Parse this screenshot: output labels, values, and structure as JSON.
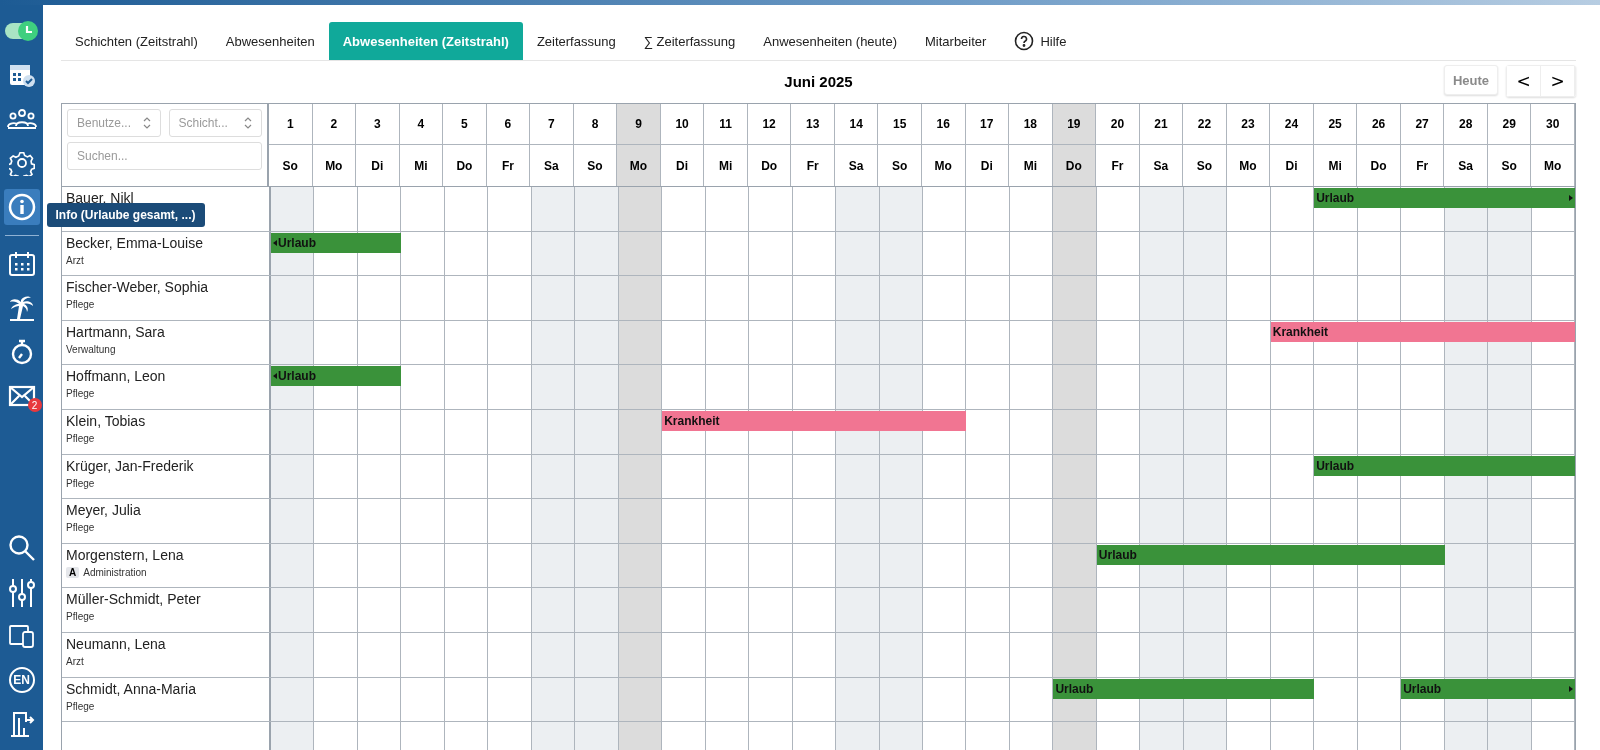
{
  "sidebar": {
    "items": [
      {
        "kind": "toggle",
        "selected": false
      },
      {
        "kind": "calendar-check",
        "selected": false
      },
      {
        "kind": "people",
        "selected": false
      },
      {
        "kind": "gear",
        "selected": false
      },
      {
        "kind": "info",
        "selected": true,
        "tooltip": "Info (Urlaube gesamt, ...)"
      },
      {
        "kind": "divider"
      },
      {
        "kind": "calendar",
        "selected": false
      },
      {
        "kind": "palm",
        "selected": false
      },
      {
        "kind": "stopwatch",
        "selected": false
      },
      {
        "kind": "mail",
        "selected": false,
        "badge": "2"
      },
      {
        "kind": "spacer"
      },
      {
        "kind": "search",
        "selected": false
      },
      {
        "kind": "sliders",
        "selected": false
      },
      {
        "kind": "devices",
        "selected": false
      },
      {
        "kind": "language",
        "selected": false,
        "label": "EN"
      },
      {
        "kind": "exit",
        "selected": false
      }
    ]
  },
  "tabs": [
    {
      "label": "Schichten (Zeitstrahl)",
      "selected": false
    },
    {
      "label": "Abwesenheiten",
      "selected": false
    },
    {
      "label": "Abwesenheiten (Zeitstrahl)",
      "selected": true
    },
    {
      "label": "Zeiterfassung",
      "selected": false
    },
    {
      "label": "∑ Zeiterfassung",
      "selected": false
    },
    {
      "label": "Anwesenheiten (heute)",
      "selected": false
    },
    {
      "label": "Mitarbeiter",
      "selected": false
    },
    {
      "label": "Hilfe",
      "selected": false,
      "kind": "help"
    }
  ],
  "month": "Juni 2025",
  "today_button": {
    "label": "Heute",
    "disabled": true
  },
  "nav": {
    "prev": "<",
    "next": ">"
  },
  "filters": {
    "user_select": {
      "placeholder": "Benutze..."
    },
    "shift_select": {
      "placeholder": "Schicht..."
    },
    "search": {
      "placeholder": "Suchen..."
    }
  },
  "days": [
    {
      "date": "1",
      "weekday": "So",
      "kind": "weekend"
    },
    {
      "date": "2",
      "weekday": "Mo",
      "kind": "normal"
    },
    {
      "date": "3",
      "weekday": "Di",
      "kind": "normal"
    },
    {
      "date": "4",
      "weekday": "Mi",
      "kind": "normal"
    },
    {
      "date": "5",
      "weekday": "Do",
      "kind": "normal"
    },
    {
      "date": "6",
      "weekday": "Fr",
      "kind": "normal"
    },
    {
      "date": "7",
      "weekday": "Sa",
      "kind": "weekend"
    },
    {
      "date": "8",
      "weekday": "So",
      "kind": "weekend"
    },
    {
      "date": "9",
      "weekday": "Mo",
      "kind": "holiday"
    },
    {
      "date": "10",
      "weekday": "Di",
      "kind": "normal"
    },
    {
      "date": "11",
      "weekday": "Mi",
      "kind": "normal"
    },
    {
      "date": "12",
      "weekday": "Do",
      "kind": "normal"
    },
    {
      "date": "13",
      "weekday": "Fr",
      "kind": "normal"
    },
    {
      "date": "14",
      "weekday": "Sa",
      "kind": "weekend"
    },
    {
      "date": "15",
      "weekday": "So",
      "kind": "weekend"
    },
    {
      "date": "16",
      "weekday": "Mo",
      "kind": "normal"
    },
    {
      "date": "17",
      "weekday": "Di",
      "kind": "normal"
    },
    {
      "date": "18",
      "weekday": "Mi",
      "kind": "normal"
    },
    {
      "date": "19",
      "weekday": "Do",
      "kind": "holiday"
    },
    {
      "date": "20",
      "weekday": "Fr",
      "kind": "normal"
    },
    {
      "date": "21",
      "weekday": "Sa",
      "kind": "weekend"
    },
    {
      "date": "22",
      "weekday": "So",
      "kind": "weekend"
    },
    {
      "date": "23",
      "weekday": "Mo",
      "kind": "normal"
    },
    {
      "date": "24",
      "weekday": "Di",
      "kind": "normal"
    },
    {
      "date": "25",
      "weekday": "Mi",
      "kind": "normal"
    },
    {
      "date": "26",
      "weekday": "Do",
      "kind": "normal"
    },
    {
      "date": "27",
      "weekday": "Fr",
      "kind": "normal"
    },
    {
      "date": "28",
      "weekday": "Sa",
      "kind": "weekend"
    },
    {
      "date": "29",
      "weekday": "So",
      "kind": "weekend"
    },
    {
      "date": "30",
      "weekday": "Mo",
      "kind": "normal"
    }
  ],
  "employees": [
    {
      "name": "Bauer, Nikl",
      "cells": [
        {
          "kind": "free"
        },
        {
          "kind": "free"
        },
        {
          "kind": "free"
        },
        {
          "kind": "free"
        },
        {
          "kind": "free"
        },
        {
          "kind": "free"
        },
        {
          "kind": "free"
        },
        {
          "kind": "free"
        },
        {
          "kind": "free"
        },
        {
          "kind": "free"
        },
        {
          "kind": "free"
        },
        {
          "kind": "free"
        },
        {
          "kind": "free"
        },
        {
          "kind": "free"
        },
        {
          "kind": "free"
        },
        {
          "kind": "free"
        },
        {
          "kind": "free"
        },
        {
          "kind": "free"
        },
        {
          "kind": "free"
        },
        {
          "kind": "free"
        },
        {
          "kind": "free"
        },
        {
          "kind": "free"
        },
        {
          "kind": "free"
        },
        {
          "kind": "free"
        },
        {
          "kind": "vacation",
          "label": "Urlaub",
          "continues_left": false,
          "continues_right": true
        },
        {
          "kind": "vacation"
        },
        {
          "kind": "vacation"
        },
        {
          "kind": "vacation"
        },
        {
          "kind": "vacation"
        },
        {
          "kind": "vacation"
        }
      ]
    },
    {
      "name": "Becker, Emma-Louise",
      "role": "Arzt",
      "cells": [
        {
          "kind": "vacation",
          "label": "Urlaub",
          "continues_left": true,
          "continues_right": false
        },
        {
          "kind": "vacation"
        },
        {
          "kind": "vacation"
        },
        {
          "kind": "free"
        },
        {
          "kind": "free"
        },
        {
          "kind": "free"
        },
        {
          "kind": "free"
        },
        {
          "kind": "free"
        },
        {
          "kind": "free"
        },
        {
          "kind": "free"
        },
        {
          "kind": "free"
        },
        {
          "kind": "free"
        },
        {
          "kind": "free"
        },
        {
          "kind": "free"
        },
        {
          "kind": "free"
        },
        {
          "kind": "free"
        },
        {
          "kind": "free"
        },
        {
          "kind": "free"
        },
        {
          "kind": "free"
        },
        {
          "kind": "free"
        },
        {
          "kind": "free"
        },
        {
          "kind": "free"
        },
        {
          "kind": "free"
        },
        {
          "kind": "free"
        },
        {
          "kind": "free"
        },
        {
          "kind": "free"
        },
        {
          "kind": "free"
        },
        {
          "kind": "free"
        },
        {
          "kind": "free"
        },
        {
          "kind": "free"
        }
      ]
    },
    {
      "name": "Fischer-Weber, Sophia",
      "role": "Pflege",
      "cells": [
        {
          "kind": "free"
        },
        {
          "kind": "free"
        },
        {
          "kind": "free"
        },
        {
          "kind": "free"
        },
        {
          "kind": "free"
        },
        {
          "kind": "free"
        },
        {
          "kind": "free"
        },
        {
          "kind": "free"
        },
        {
          "kind": "free"
        },
        {
          "kind": "free"
        },
        {
          "kind": "free"
        },
        {
          "kind": "free"
        },
        {
          "kind": "free"
        },
        {
          "kind": "free"
        },
        {
          "kind": "free"
        },
        {
          "kind": "free"
        },
        {
          "kind": "free"
        },
        {
          "kind": "free"
        },
        {
          "kind": "free"
        },
        {
          "kind": "free"
        },
        {
          "kind": "free"
        },
        {
          "kind": "free"
        },
        {
          "kind": "free"
        },
        {
          "kind": "free"
        },
        {
          "kind": "free"
        },
        {
          "kind": "free"
        },
        {
          "kind": "free"
        },
        {
          "kind": "free"
        },
        {
          "kind": "free"
        },
        {
          "kind": "free"
        }
      ]
    },
    {
      "name": "Hartmann, Sara",
      "role": "Verwaltung",
      "cells": [
        {
          "kind": "free"
        },
        {
          "kind": "free"
        },
        {
          "kind": "free"
        },
        {
          "kind": "free"
        },
        {
          "kind": "free"
        },
        {
          "kind": "free"
        },
        {
          "kind": "free"
        },
        {
          "kind": "free"
        },
        {
          "kind": "free"
        },
        {
          "kind": "free"
        },
        {
          "kind": "free"
        },
        {
          "kind": "free"
        },
        {
          "kind": "free"
        },
        {
          "kind": "free"
        },
        {
          "kind": "free"
        },
        {
          "kind": "free"
        },
        {
          "kind": "free"
        },
        {
          "kind": "free"
        },
        {
          "kind": "free"
        },
        {
          "kind": "free"
        },
        {
          "kind": "free"
        },
        {
          "kind": "free"
        },
        {
          "kind": "free"
        },
        {
          "kind": "sickness",
          "label": "Krankheit",
          "continues_left": false,
          "continues_right": false
        },
        {
          "kind": "sickness"
        },
        {
          "kind": "sickness"
        },
        {
          "kind": "sickness"
        },
        {
          "kind": "sickness"
        },
        {
          "kind": "sickness"
        },
        {
          "kind": "sickness"
        }
      ]
    },
    {
      "name": "Hoffmann, Leon",
      "role": "Pflege",
      "cells": [
        {
          "kind": "vacation",
          "label": "Urlaub",
          "continues_left": true,
          "continues_right": false
        },
        {
          "kind": "vacation"
        },
        {
          "kind": "vacation"
        },
        {
          "kind": "free"
        },
        {
          "kind": "free"
        },
        {
          "kind": "free"
        },
        {
          "kind": "free"
        },
        {
          "kind": "free"
        },
        {
          "kind": "free"
        },
        {
          "kind": "free"
        },
        {
          "kind": "free"
        },
        {
          "kind": "free"
        },
        {
          "kind": "free"
        },
        {
          "kind": "free"
        },
        {
          "kind": "free"
        },
        {
          "kind": "free"
        },
        {
          "kind": "free"
        },
        {
          "kind": "free"
        },
        {
          "kind": "free"
        },
        {
          "kind": "free"
        },
        {
          "kind": "free"
        },
        {
          "kind": "free"
        },
        {
          "kind": "free"
        },
        {
          "kind": "free"
        },
        {
          "kind": "free"
        },
        {
          "kind": "free"
        },
        {
          "kind": "free"
        },
        {
          "kind": "free"
        },
        {
          "kind": "free"
        },
        {
          "kind": "free"
        }
      ]
    },
    {
      "name": "Klein, Tobias",
      "role": "Pflege",
      "cells": [
        {
          "kind": "free"
        },
        {
          "kind": "free"
        },
        {
          "kind": "free"
        },
        {
          "kind": "free"
        },
        {
          "kind": "free"
        },
        {
          "kind": "free"
        },
        {
          "kind": "free"
        },
        {
          "kind": "free"
        },
        {
          "kind": "free"
        },
        {
          "kind": "sickness",
          "label": "Krankheit",
          "continues_left": false,
          "continues_right": false
        },
        {
          "kind": "sickness"
        },
        {
          "kind": "sickness"
        },
        {
          "kind": "sickness"
        },
        {
          "kind": "sickness"
        },
        {
          "kind": "sickness"
        },
        {
          "kind": "sickness"
        },
        {
          "kind": "free"
        },
        {
          "kind": "free"
        },
        {
          "kind": "free"
        },
        {
          "kind": "free"
        },
        {
          "kind": "free"
        },
        {
          "kind": "free"
        },
        {
          "kind": "free"
        },
        {
          "kind": "free"
        },
        {
          "kind": "free"
        },
        {
          "kind": "free"
        },
        {
          "kind": "free"
        },
        {
          "kind": "free"
        },
        {
          "kind": "free"
        },
        {
          "kind": "free"
        }
      ]
    },
    {
      "name": "Krüger, Jan-Frederik",
      "role": "Pflege",
      "cells": [
        {
          "kind": "free"
        },
        {
          "kind": "free"
        },
        {
          "kind": "free"
        },
        {
          "kind": "free"
        },
        {
          "kind": "free"
        },
        {
          "kind": "free"
        },
        {
          "kind": "free"
        },
        {
          "kind": "free"
        },
        {
          "kind": "free"
        },
        {
          "kind": "free"
        },
        {
          "kind": "free"
        },
        {
          "kind": "free"
        },
        {
          "kind": "free"
        },
        {
          "kind": "free"
        },
        {
          "kind": "free"
        },
        {
          "kind": "free"
        },
        {
          "kind": "free"
        },
        {
          "kind": "free"
        },
        {
          "kind": "free"
        },
        {
          "kind": "free"
        },
        {
          "kind": "free"
        },
        {
          "kind": "free"
        },
        {
          "kind": "free"
        },
        {
          "kind": "free"
        },
        {
          "kind": "vacation",
          "label": "Urlaub",
          "continues_left": false,
          "continues_right": false
        },
        {
          "kind": "vacation"
        },
        {
          "kind": "vacation"
        },
        {
          "kind": "vacation"
        },
        {
          "kind": "vacation"
        },
        {
          "kind": "vacation"
        }
      ]
    },
    {
      "name": "Meyer, Julia",
      "role": "Pflege",
      "cells": [
        {
          "kind": "free"
        },
        {
          "kind": "free"
        },
        {
          "kind": "free"
        },
        {
          "kind": "free"
        },
        {
          "kind": "free"
        },
        {
          "kind": "free"
        },
        {
          "kind": "free"
        },
        {
          "kind": "free"
        },
        {
          "kind": "free"
        },
        {
          "kind": "free"
        },
        {
          "kind": "free"
        },
        {
          "kind": "free"
        },
        {
          "kind": "free"
        },
        {
          "kind": "free"
        },
        {
          "kind": "free"
        },
        {
          "kind": "free"
        },
        {
          "kind": "free"
        },
        {
          "kind": "free"
        },
        {
          "kind": "free"
        },
        {
          "kind": "free"
        },
        {
          "kind": "free"
        },
        {
          "kind": "free"
        },
        {
          "kind": "free"
        },
        {
          "kind": "free"
        },
        {
          "kind": "free"
        },
        {
          "kind": "free"
        },
        {
          "kind": "free"
        },
        {
          "kind": "free"
        },
        {
          "kind": "free"
        },
        {
          "kind": "free"
        }
      ]
    },
    {
      "name": "Morgenstern, Lena",
      "role_badge": "A",
      "role": "Administration",
      "cells": [
        {
          "kind": "free"
        },
        {
          "kind": "free"
        },
        {
          "kind": "free"
        },
        {
          "kind": "free"
        },
        {
          "kind": "free"
        },
        {
          "kind": "free"
        },
        {
          "kind": "free"
        },
        {
          "kind": "free"
        },
        {
          "kind": "free"
        },
        {
          "kind": "free"
        },
        {
          "kind": "free"
        },
        {
          "kind": "free"
        },
        {
          "kind": "free"
        },
        {
          "kind": "free"
        },
        {
          "kind": "free"
        },
        {
          "kind": "free"
        },
        {
          "kind": "free"
        },
        {
          "kind": "free"
        },
        {
          "kind": "free"
        },
        {
          "kind": "vacation",
          "label": "Urlaub",
          "continues_left": false,
          "continues_right": false
        },
        {
          "kind": "vacation"
        },
        {
          "kind": "vacation"
        },
        {
          "kind": "vacation"
        },
        {
          "kind": "vacation"
        },
        {
          "kind": "vacation"
        },
        {
          "kind": "vacation"
        },
        {
          "kind": "vacation"
        },
        {
          "kind": "free"
        },
        {
          "kind": "free"
        },
        {
          "kind": "free"
        }
      ]
    },
    {
      "name": "Müller-Schmidt, Peter",
      "role": "Pflege",
      "cells": [
        {
          "kind": "free"
        },
        {
          "kind": "free"
        },
        {
          "kind": "free"
        },
        {
          "kind": "free"
        },
        {
          "kind": "free"
        },
        {
          "kind": "free"
        },
        {
          "kind": "free"
        },
        {
          "kind": "free"
        },
        {
          "kind": "free"
        },
        {
          "kind": "free"
        },
        {
          "kind": "free"
        },
        {
          "kind": "free"
        },
        {
          "kind": "free"
        },
        {
          "kind": "free"
        },
        {
          "kind": "free"
        },
        {
          "kind": "free"
        },
        {
          "kind": "free"
        },
        {
          "kind": "free"
        },
        {
          "kind": "free"
        },
        {
          "kind": "free"
        },
        {
          "kind": "free"
        },
        {
          "kind": "free"
        },
        {
          "kind": "free"
        },
        {
          "kind": "free"
        },
        {
          "kind": "free"
        },
        {
          "kind": "free"
        },
        {
          "kind": "free"
        },
        {
          "kind": "free"
        },
        {
          "kind": "free"
        },
        {
          "kind": "free"
        }
      ]
    },
    {
      "name": "Neumann, Lena",
      "role": "Arzt",
      "cells": [
        {
          "kind": "free"
        },
        {
          "kind": "free"
        },
        {
          "kind": "free"
        },
        {
          "kind": "free"
        },
        {
          "kind": "free"
        },
        {
          "kind": "free"
        },
        {
          "kind": "free"
        },
        {
          "kind": "free"
        },
        {
          "kind": "free"
        },
        {
          "kind": "free"
        },
        {
          "kind": "free"
        },
        {
          "kind": "free"
        },
        {
          "kind": "free"
        },
        {
          "kind": "free"
        },
        {
          "kind": "free"
        },
        {
          "kind": "free"
        },
        {
          "kind": "free"
        },
        {
          "kind": "free"
        },
        {
          "kind": "free"
        },
        {
          "kind": "free"
        },
        {
          "kind": "free"
        },
        {
          "kind": "free"
        },
        {
          "kind": "free"
        },
        {
          "kind": "free"
        },
        {
          "kind": "free"
        },
        {
          "kind": "free"
        },
        {
          "kind": "free"
        },
        {
          "kind": "free"
        },
        {
          "kind": "free"
        },
        {
          "kind": "free"
        }
      ]
    },
    {
      "name": "Schmidt, Anna-Maria",
      "role": "Pflege",
      "cells": [
        {
          "kind": "free"
        },
        {
          "kind": "free"
        },
        {
          "kind": "free"
        },
        {
          "kind": "free"
        },
        {
          "kind": "free"
        },
        {
          "kind": "free"
        },
        {
          "kind": "free"
        },
        {
          "kind": "free"
        },
        {
          "kind": "free"
        },
        {
          "kind": "free"
        },
        {
          "kind": "free"
        },
        {
          "kind": "free"
        },
        {
          "kind": "free"
        },
        {
          "kind": "free"
        },
        {
          "kind": "free"
        },
        {
          "kind": "free"
        },
        {
          "kind": "free"
        },
        {
          "kind": "free"
        },
        {
          "kind": "vacation",
          "label": "Urlaub",
          "continues_left": false,
          "continues_right": false
        },
        {
          "kind": "vacation"
        },
        {
          "kind": "vacation"
        },
        {
          "kind": "vacation"
        },
        {
          "kind": "vacation"
        },
        {
          "kind": "vacation"
        },
        {
          "kind": "free"
        },
        {
          "kind": "free"
        },
        {
          "kind": "vacation",
          "label": "Urlaub",
          "continues_left": false,
          "continues_right": true
        },
        {
          "kind": "vacation"
        },
        {
          "kind": "vacation"
        },
        {
          "kind": "vacation"
        }
      ]
    }
  ]
}
